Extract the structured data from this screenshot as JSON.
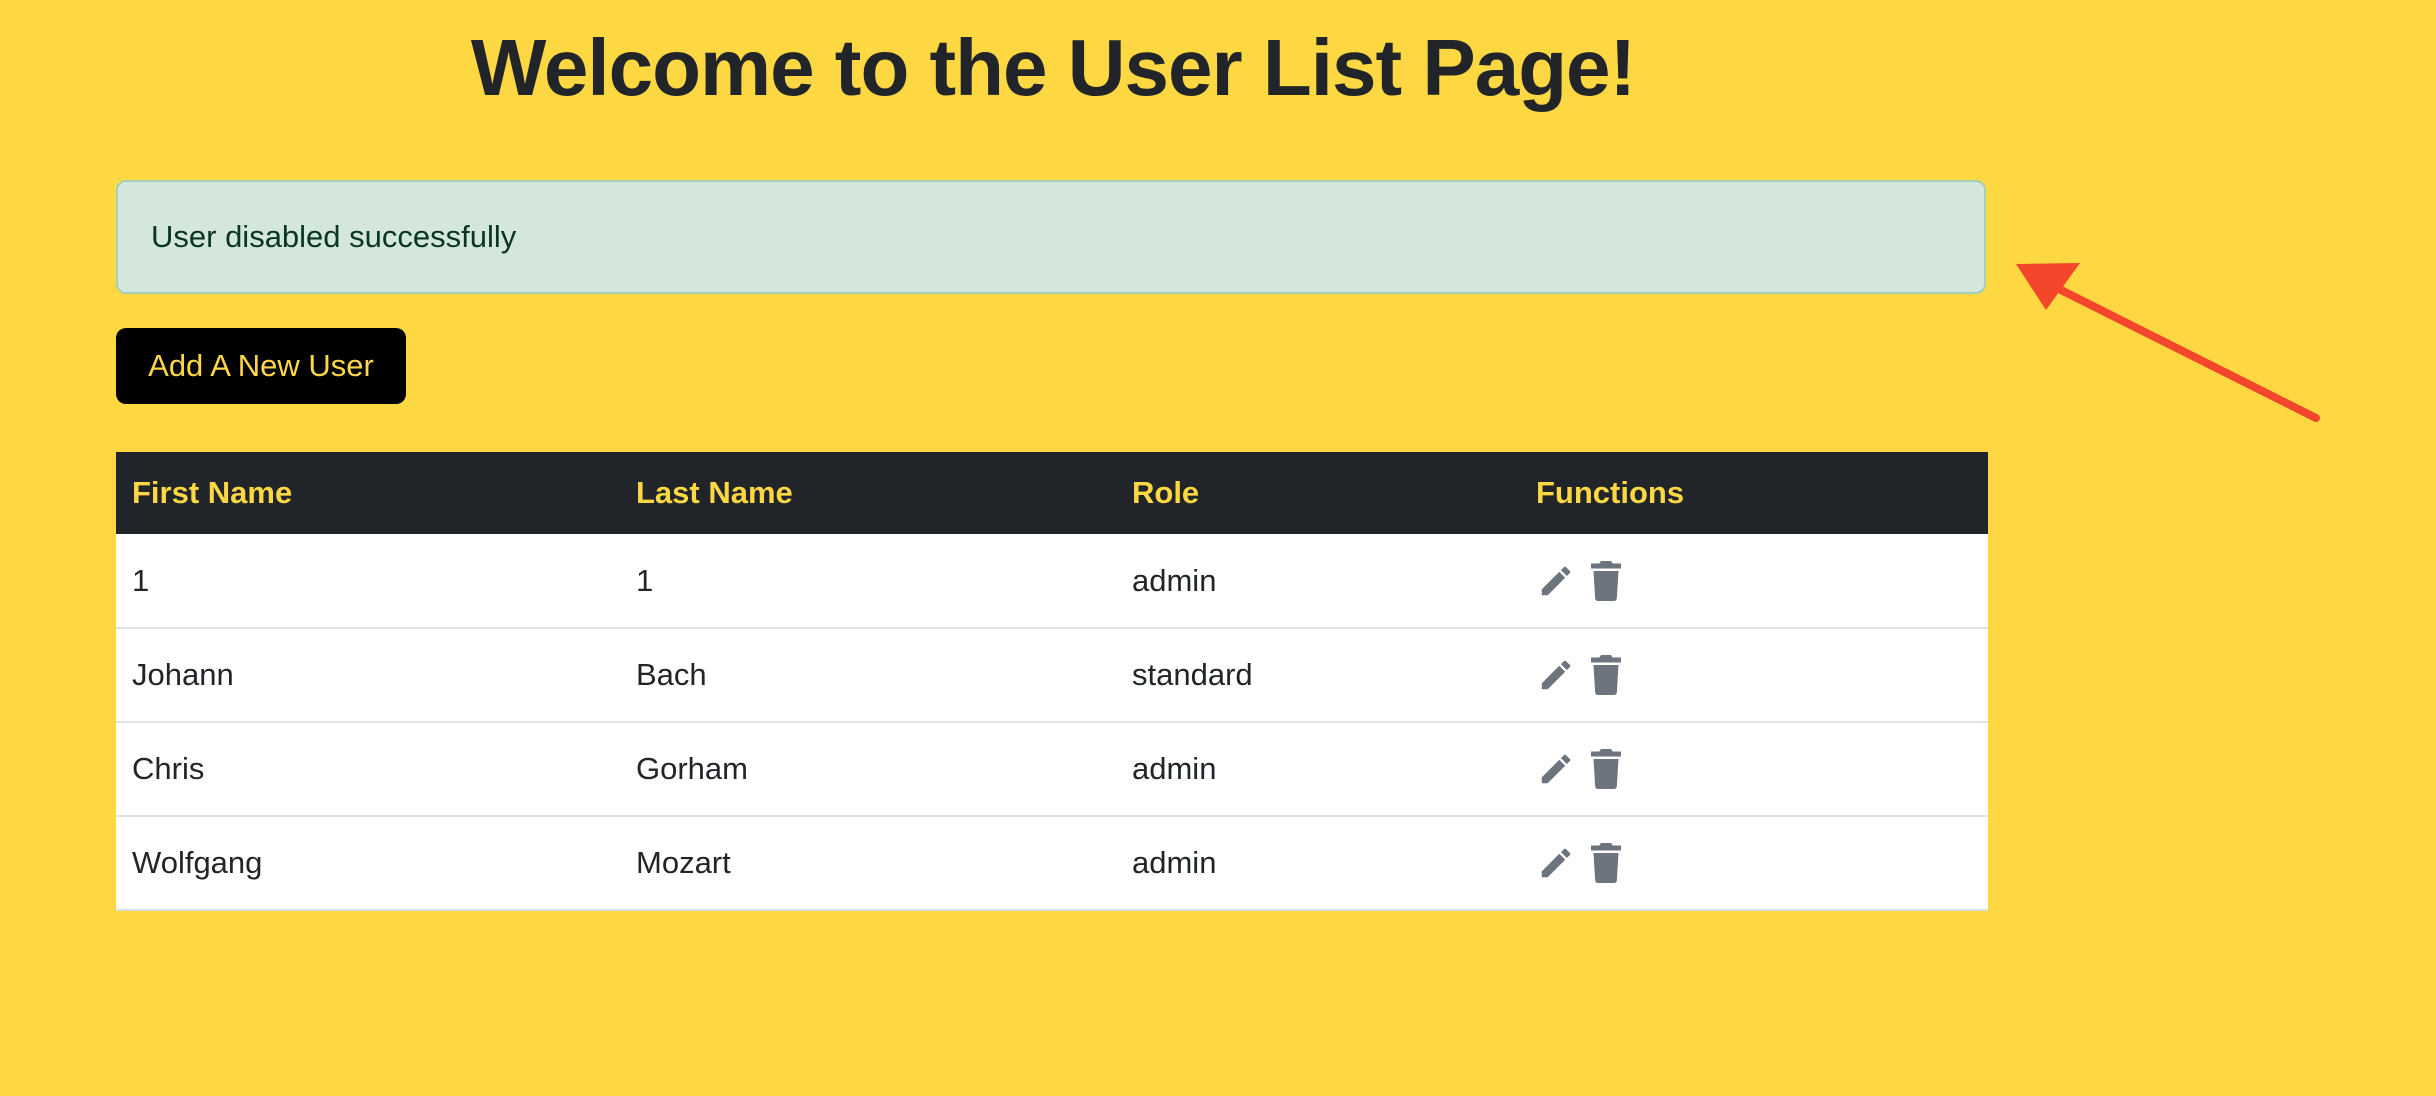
{
  "page": {
    "title": "Welcome to the User List Page!",
    "background": "#fdd842"
  },
  "alert": {
    "message": "User disabled successfully",
    "type": "success"
  },
  "actions": {
    "add_user_label": "Add A New User"
  },
  "table": {
    "headers": [
      "First Name",
      "Last Name",
      "Role",
      "Functions"
    ],
    "rows": [
      {
        "first": "1",
        "last": "1",
        "role": "admin"
      },
      {
        "first": "Johann",
        "last": "Bach",
        "role": "standard"
      },
      {
        "first": "Chris",
        "last": "Gorham",
        "role": "admin"
      },
      {
        "first": "Wolfgang",
        "last": "Mozart",
        "role": "admin"
      }
    ],
    "row_icons": [
      "pencil-icon",
      "trash-icon"
    ]
  },
  "annotation": {
    "icon": "arrow-icon",
    "color": "#f4462a"
  }
}
